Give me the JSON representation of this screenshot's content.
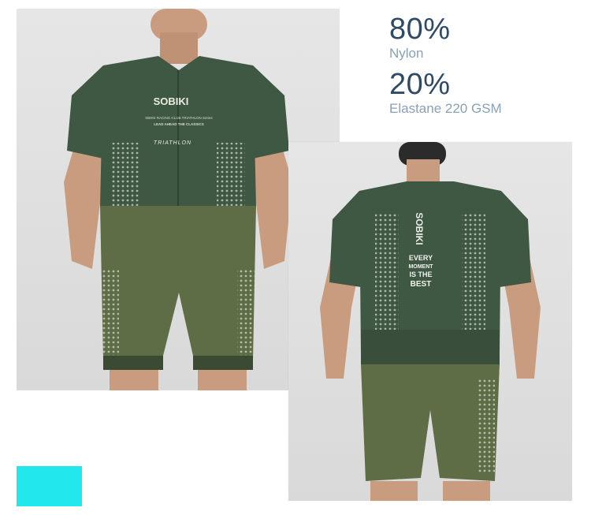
{
  "specs": [
    {
      "percent": "80%",
      "material": "Nylon"
    },
    {
      "percent": "20%",
      "material": "Elastane 220 GSM"
    }
  ],
  "garment_text": {
    "front_brand": "SOBIKI",
    "front_small_1": "SBIKE RACING CLUB TRIATHLON Series",
    "front_small_2": "LEAD AHEAD THE CLASSICS",
    "front_triathlon": "TRIATHLON",
    "back_brand": "SOBIKI",
    "back_slogan": [
      "EVERY",
      "MOMENT",
      "IS THE",
      "BEST"
    ]
  },
  "colors": {
    "accent_cyan": "#22e8ee",
    "spec_text": "#2f4a66",
    "spec_subtext": "#8aa0b7",
    "suit_upper": "#3f5843",
    "suit_lower": "#5f6d46",
    "skin": "#c99c80",
    "photo_bg": "#e1e1e1"
  }
}
